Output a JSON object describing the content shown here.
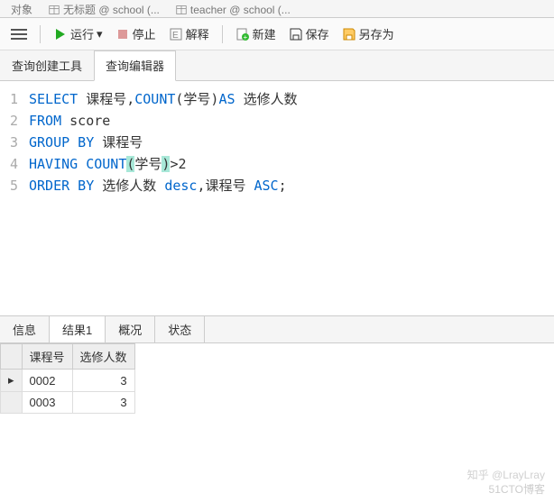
{
  "topTabs": [
    "对象",
    "无标题 @ school (...",
    "teacher @ school (..."
  ],
  "toolbar": {
    "run": "运行",
    "stop": "停止",
    "explain": "解释",
    "new": "新建",
    "save": "保存",
    "saveAs": "另存为"
  },
  "editorTabs": {
    "builder": "查询创建工具",
    "editor": "查询编辑器"
  },
  "code": {
    "l1": {
      "kw1": "SELECT ",
      "t1": "课程号,",
      "kw2": "COUNT",
      "t2": "(学号)",
      "kw3": "AS ",
      "t3": "选修人数"
    },
    "l2": {
      "kw1": "FROM ",
      "t1": "score"
    },
    "l3": {
      "kw1": "GROUP BY ",
      "t1": "课程号"
    },
    "l4": {
      "kw1": "HAVING ",
      "kw2": "COUNT",
      "p1": "(",
      "t1": "学号",
      "p2": ")",
      "t2": ">2"
    },
    "l5": {
      "kw1": "ORDER BY ",
      "t1": "选修人数 ",
      "kw2": "desc",
      "t2": ",课程号 ",
      "kw3": "ASC",
      "t3": ";"
    }
  },
  "resultTabs": {
    "info": "信息",
    "result": "结果1",
    "profile": "概况",
    "status": "状态"
  },
  "grid": {
    "cols": [
      "课程号",
      "选修人数"
    ],
    "rows": [
      {
        "c0": "0002",
        "c1": "3"
      },
      {
        "c0": "0003",
        "c1": "3"
      }
    ]
  },
  "watermark1": "知乎 @LrayLray",
  "watermark2": "51CTO博客"
}
